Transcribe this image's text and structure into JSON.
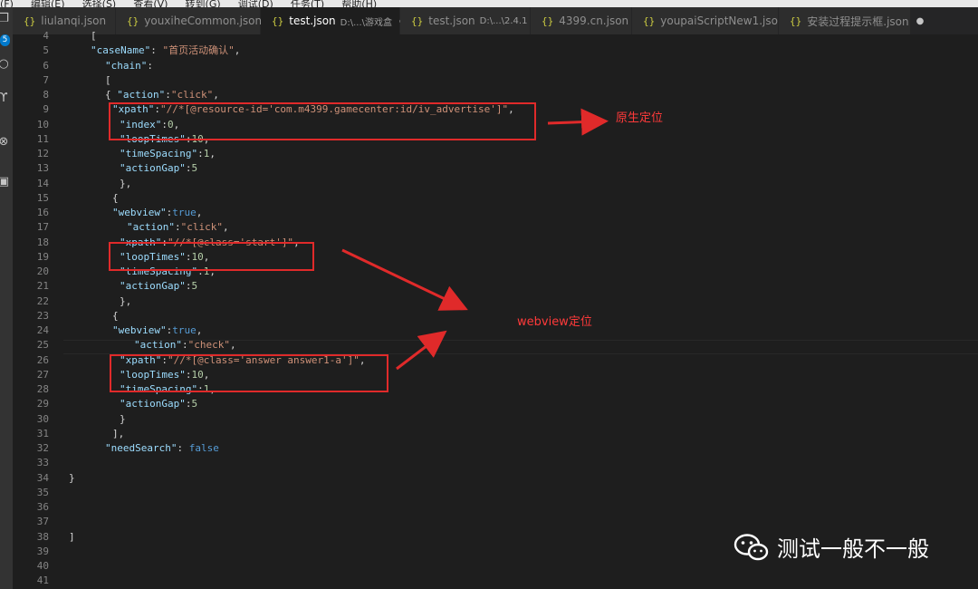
{
  "menu": [
    "(F)",
    "编辑(E)",
    "选择(S)",
    "查看(V)",
    "转到(G)",
    "调试(D)",
    "任务(T)",
    "帮助(H)"
  ],
  "activity": {
    "badge": "5"
  },
  "tabs": [
    {
      "name": "liulanqi.json",
      "path": "",
      "active": false,
      "modified": false
    },
    {
      "name": "youxiheCommon.json",
      "path": "",
      "active": false,
      "modified": false
    },
    {
      "name": "test.json",
      "path": "D:\\...\\游戏盒",
      "active": true,
      "modified": true
    },
    {
      "name": "test.json",
      "path": "D:\\...\\2.4.1",
      "active": false,
      "modified": true
    },
    {
      "name": "4399.cn.json",
      "path": "",
      "active": false,
      "modified": true
    },
    {
      "name": "youpaiScriptNew1.json",
      "path": "",
      "active": false,
      "modified": true
    },
    {
      "name": "安装过程提示框.json",
      "path": "",
      "active": false,
      "modified": true
    }
  ],
  "tab_icon": "{}",
  "code_lines": [
    {
      "num": "4",
      "text": "["
    },
    {
      "num": "5",
      "text": "\"caseName\": \"首页活动确认\","
    },
    {
      "num": "6",
      "text": "\"chain\":"
    },
    {
      "num": "7",
      "text": "["
    },
    {
      "num": "8",
      "text": "{ \"action\":\"click\","
    },
    {
      "num": "9",
      "text": "\"xpath\":\"//*[@resource-id='com.m4399.gamecenter:id/iv_advertise']\","
    },
    {
      "num": "10",
      "text": "\"index\":0,"
    },
    {
      "num": "11",
      "text": "\"loopTimes\":10,"
    },
    {
      "num": "12",
      "text": "\"timeSpacing\":1,"
    },
    {
      "num": "13",
      "text": "\"actionGap\":5"
    },
    {
      "num": "14",
      "text": "},"
    },
    {
      "num": "15",
      "text": "{"
    },
    {
      "num": "16",
      "text": "\"webview\":true,"
    },
    {
      "num": "17",
      "text": "\"action\":\"click\","
    },
    {
      "num": "18",
      "text": "\"xpath\":\"//*[@class='start']\","
    },
    {
      "num": "19",
      "text": "\"loopTimes\":10,"
    },
    {
      "num": "20",
      "text": "\"timeSpacing\":1,"
    },
    {
      "num": "21",
      "text": "\"actionGap\":5"
    },
    {
      "num": "22",
      "text": "},"
    },
    {
      "num": "23",
      "text": "{"
    },
    {
      "num": "24",
      "text": "\"webview\":true,"
    },
    {
      "num": "25",
      "text": "\"action\":\"check\","
    },
    {
      "num": "26",
      "text": "\"xpath\":\"//*[@class='answer answer1-a']\","
    },
    {
      "num": "27",
      "text": "\"loopTimes\":10,"
    },
    {
      "num": "28",
      "text": "\"timeSpacing\":1,"
    },
    {
      "num": "29",
      "text": "\"actionGap\":5"
    },
    {
      "num": "30",
      "text": "}"
    },
    {
      "num": "31",
      "text": "],"
    },
    {
      "num": "32",
      "text": "\"needSearch\": false"
    },
    {
      "num": "33",
      "text": ""
    },
    {
      "num": "34",
      "text": "}"
    },
    {
      "num": "35",
      "text": ""
    },
    {
      "num": "36",
      "text": ""
    },
    {
      "num": "37",
      "text": ""
    },
    {
      "num": "38",
      "text": "]"
    },
    {
      "num": "39",
      "text": ""
    },
    {
      "num": "40",
      "text": ""
    },
    {
      "num": "41",
      "text": ""
    }
  ],
  "annotations": {
    "native": "原生定位",
    "webview": "webview定位"
  },
  "watermark": "测试一般不一般",
  "colors": {
    "highlight": "#e02a2a",
    "accent": "#007acc"
  }
}
